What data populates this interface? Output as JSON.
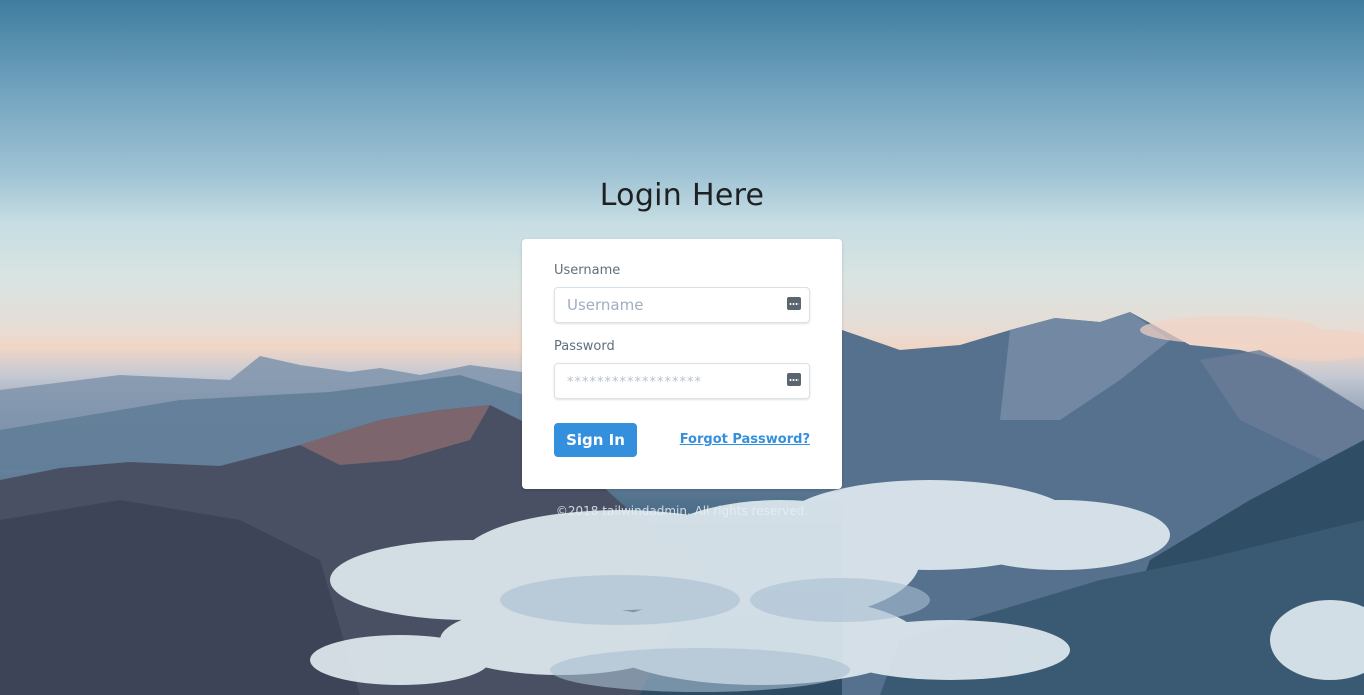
{
  "page": {
    "title": "Login Here"
  },
  "form": {
    "username_label": "Username",
    "username_placeholder": "Username",
    "username_icon": "keyboard-icon",
    "password_label": "Password",
    "password_placeholder": "******************",
    "password_icon": "keyboard-icon",
    "signin_label": "Sign In",
    "forgot_label": "Forgot Password?"
  },
  "footer": {
    "copyright": "©2018 tailwindadmin. All rights reserved."
  },
  "colors": {
    "primary": "#3490dc",
    "card_bg": "#ffffff",
    "title_text": "#1e2024"
  }
}
